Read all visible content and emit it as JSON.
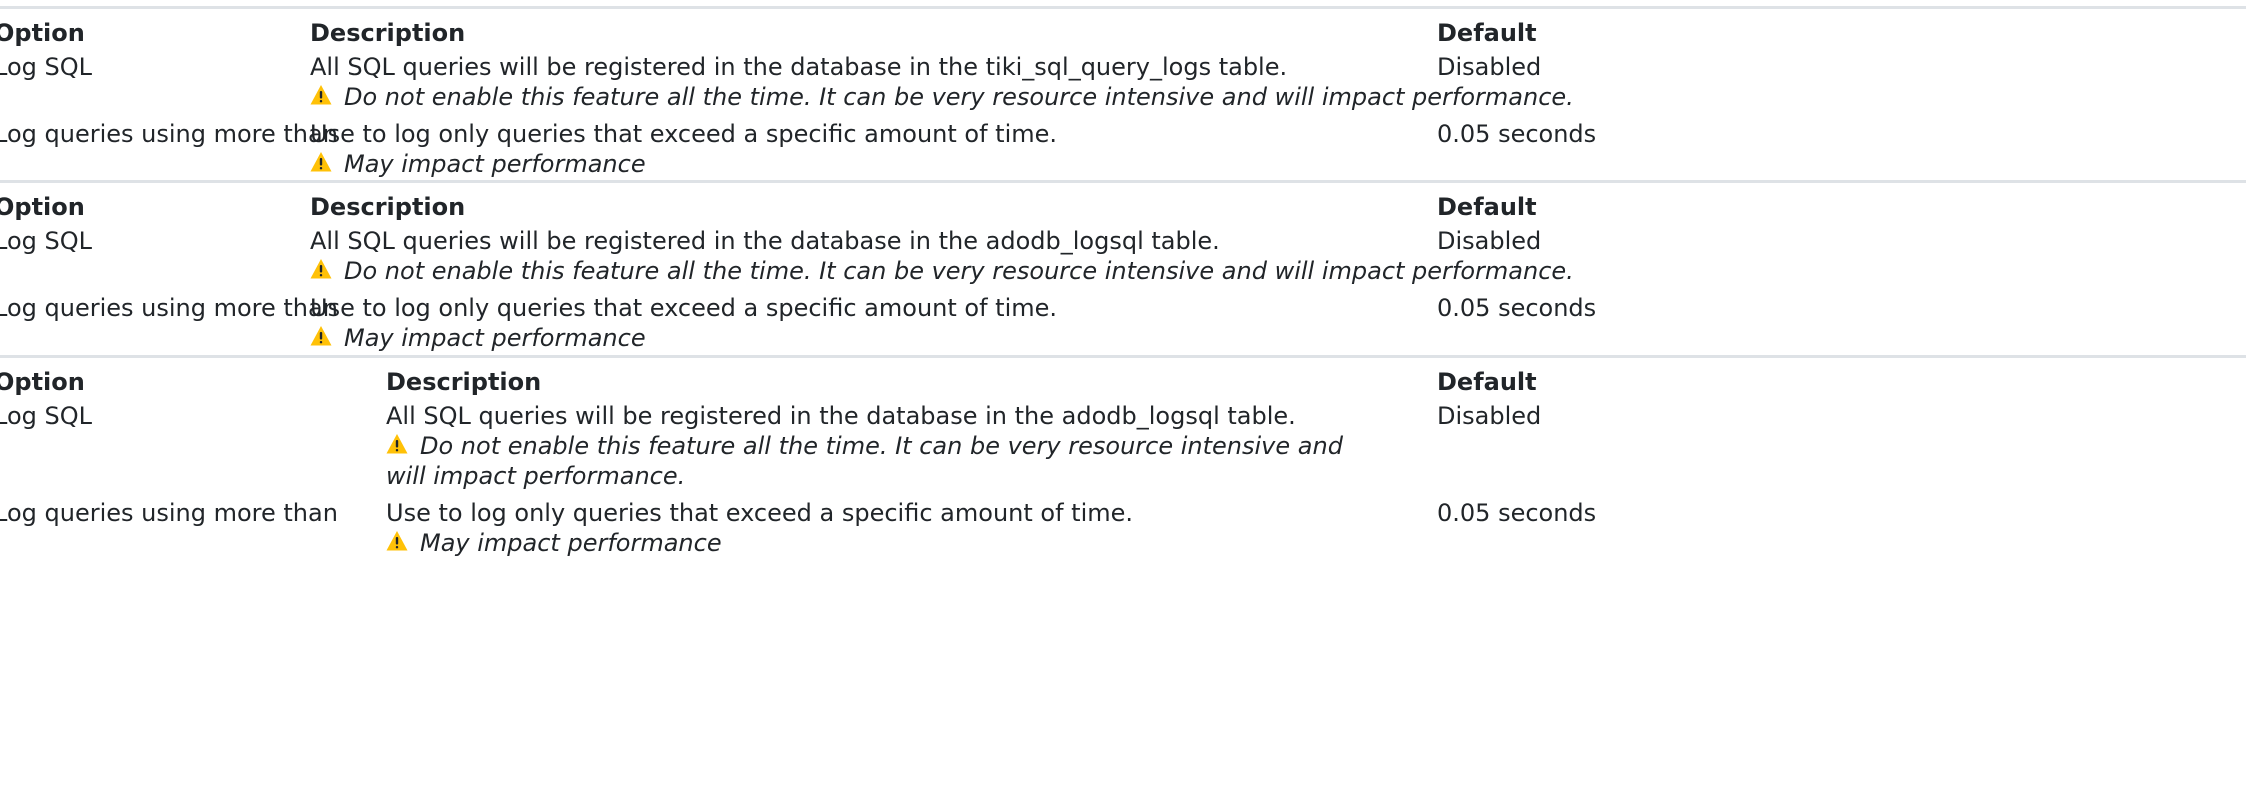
{
  "tables": [
    {
      "headers": {
        "option": "Option",
        "description": "Description",
        "default": "Default"
      },
      "rows": [
        {
          "option": "Log SQL",
          "description": "All SQL queries will be registered in the database in the tiki_sql_query_logs table.",
          "warning": "Do not enable this feature all the time. It can be very resource intensive and will impact performance.",
          "default": "Disabled"
        },
        {
          "option": "Log queries using more than",
          "description": "Use to log only queries that exceed a specific amount of time.",
          "warning": "May impact performance",
          "default": "0.05 seconds"
        }
      ]
    },
    {
      "headers": {
        "option": "Option",
        "description": "Description",
        "default": "Default"
      },
      "rows": [
        {
          "option": "Log SQL",
          "description": "All SQL queries will be registered in the database in the adodb_logsql table.",
          "warning": "Do not enable this feature all the time. It can be very resource intensive and will impact performance.",
          "default": "Disabled"
        },
        {
          "option": "Log queries using more than",
          "description": "Use to log only queries that exceed a specific amount of time.",
          "warning": "May impact performance",
          "default": "0.05 seconds"
        }
      ]
    },
    {
      "headers": {
        "option": "Option",
        "description": "Description",
        "default": "Default"
      },
      "rows": [
        {
          "option": "Log SQL",
          "description": "All SQL queries will be registered in the database in the adodb_logsql table.",
          "warning": "Do not enable this feature all the time. It can be very resource intensive and will impact performance.",
          "default": "Disabled"
        },
        {
          "option": "Log queries using more than",
          "description": "Use to log only queries that exceed a specific amount of time.",
          "warning": "May impact performance",
          "default": "0.05 seconds"
        }
      ]
    }
  ],
  "icons": {
    "warning": "warning-triangle-icon"
  },
  "colors": {
    "warning": "#ffc107",
    "rule": "#dee2e6",
    "text": "#212529"
  }
}
